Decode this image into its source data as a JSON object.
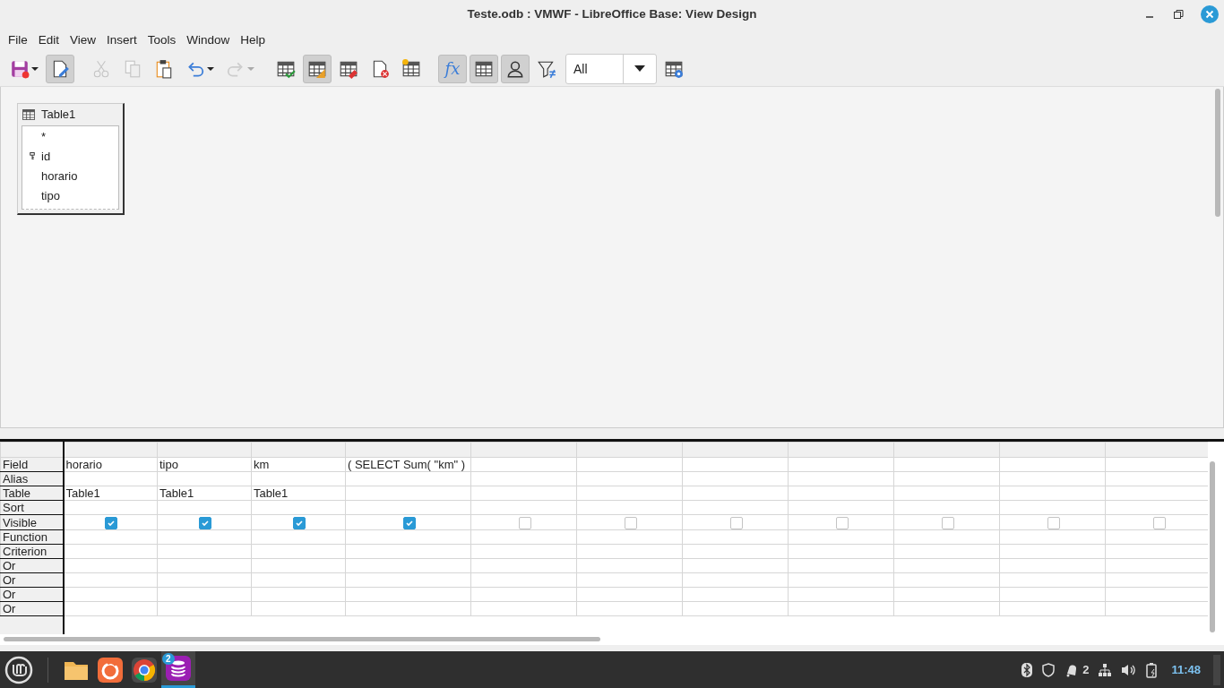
{
  "window": {
    "title": "Teste.odb : VMWF - LibreOffice Base: View Design"
  },
  "menu": [
    "File",
    "Edit",
    "View",
    "Insert",
    "Tools",
    "Window",
    "Help"
  ],
  "toolbar": [
    {
      "kind": "split",
      "pressed": false,
      "disabled": false
    },
    {
      "kind": "plain",
      "pressed": true,
      "disabled": false
    },
    {
      "kind": "plain",
      "pressed": false,
      "disabled": true
    },
    {
      "kind": "plain",
      "pressed": false,
      "disabled": true
    },
    {
      "kind": "plain",
      "pressed": false,
      "disabled": false
    },
    {
      "kind": "split",
      "pressed": false,
      "disabled": false
    },
    {
      "kind": "split",
      "pressed": false,
      "disabled": true
    },
    {
      "kind": "plain",
      "pressed": false,
      "disabled": false
    },
    {
      "kind": "plain",
      "pressed": true,
      "disabled": false
    },
    {
      "kind": "plain",
      "pressed": false,
      "disabled": false
    },
    {
      "kind": "plain",
      "pressed": false,
      "disabled": false
    },
    {
      "kind": "plain",
      "pressed": false,
      "disabled": false
    },
    {
      "kind": "plain",
      "pressed": true,
      "disabled": false,
      "label": "fx"
    },
    {
      "kind": "plain",
      "pressed": true,
      "disabled": false
    },
    {
      "kind": "plain",
      "pressed": true,
      "disabled": false
    },
    {
      "kind": "plain",
      "pressed": false,
      "disabled": false
    }
  ],
  "limit": {
    "value": "All"
  },
  "table_window": {
    "title": "Table1",
    "fields": [
      {
        "name": "*",
        "primary_key": false
      },
      {
        "name": "id",
        "primary_key": true
      },
      {
        "name": "horario",
        "primary_key": false
      },
      {
        "name": "tipo",
        "primary_key": false
      }
    ]
  },
  "grid": {
    "row_labels": [
      "Field",
      "Alias",
      "Table",
      "Sort",
      "Visible",
      "Function",
      "Criterion",
      "Or",
      "Or",
      "Or",
      "Or"
    ],
    "columns": [
      {
        "field": "horario",
        "table": "Table1",
        "visible": true
      },
      {
        "field": "tipo",
        "table": "Table1",
        "visible": true
      },
      {
        "field": "km",
        "table": "Table1",
        "visible": true
      },
      {
        "field": "( SELECT Sum( \"km\" )",
        "visible": true
      },
      {
        "visible": false
      },
      {
        "visible": false
      },
      {
        "visible": false
      },
      {
        "visible": false
      },
      {
        "visible": false
      },
      {
        "visible": false
      },
      {
        "visible": false
      }
    ]
  },
  "taskbar": {
    "apps": [
      {
        "active": false
      },
      {
        "active": false
      },
      {
        "active": false
      },
      {
        "active": true,
        "badge": "2"
      }
    ],
    "notifications": "2",
    "clock": "11:48"
  }
}
